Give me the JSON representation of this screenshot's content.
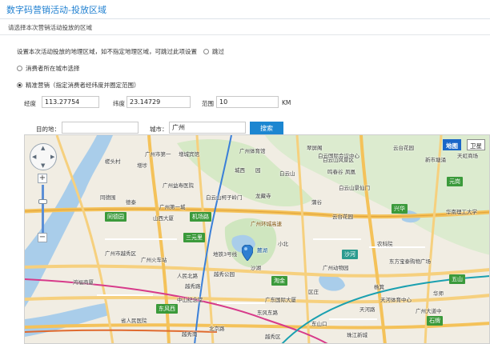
{
  "header": {
    "title": "数字码营销活动-投放区域"
  },
  "subtitle": "请选择本次营销活动投放的区域",
  "area_setting": {
    "hint": "设置本次活动投放的地理区域，如不指定地理区域，可跳过此项设置",
    "skip_label": "跳过"
  },
  "options": {
    "consumer_city_label": "消费者所在城市选择",
    "precise_label": "精准营销（指定消费者经纬度并圈定范围）"
  },
  "coords": {
    "longitude_label": "经度",
    "longitude_value": "113.27754",
    "latitude_label": "纬度",
    "latitude_value": "23.14729",
    "range_label": "范围",
    "range_value": "10",
    "range_unit": "KM"
  },
  "search": {
    "destination_label": "目的地：",
    "destination_value": "",
    "city_label": "城市：",
    "city_value": "广州",
    "button_label": "搜索"
  },
  "map": {
    "type_map": "地图",
    "type_satellite": "卫星",
    "pin_icon": "map-marker-icon",
    "labels": [
      "翠屏阁",
      "白云国际会议中心",
      "广州体育馆",
      "广州市第一",
      "白云山风景区",
      "云台花园",
      "新市塘涌",
      "天虹商场",
      "槎头村",
      "增埗",
      "增城宾馆",
      "园",
      "城西",
      "白云山",
      "鸣春谷",
      "广州益寿医院",
      "凤凰",
      "同德围",
      "德泰",
      "广州第一城",
      "白云山柯子岭门",
      "龙藏寺",
      "蒲谷",
      "白云山景仙门",
      "元岗",
      "同德园",
      "山西大厦",
      "机场路",
      "广州环城高速",
      "云台花园",
      "兴华",
      "华南理工大学",
      "三元里",
      "地铁3号线",
      "麓湖",
      "小北",
      "沙河",
      "农科院",
      "东方宝泰购物广场",
      "淘金",
      "广州动物园",
      "五山",
      "沙湖",
      "广州火车站",
      "鸿福商厦",
      "广州市越秀区",
      "越秀公园",
      "人民北路",
      "越秀路",
      "广东国际大厦",
      "杨箕",
      "天河体育中心",
      "华师",
      "东风西",
      "中山纪念堂",
      "东风东路",
      "省人民医院",
      "北京路",
      "区庄",
      "天河路",
      "广州大道中",
      "越秀南",
      "石牌",
      "东山口",
      "越秀区",
      "珠江新城"
    ]
  }
}
